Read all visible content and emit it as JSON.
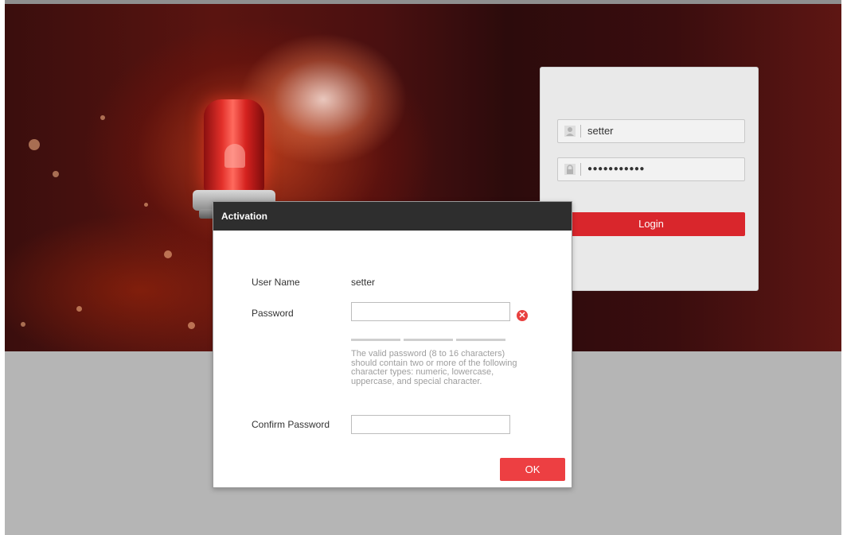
{
  "login": {
    "username_value": "setter",
    "password_value": "●●●●●●●●●●●",
    "login_label": "Login"
  },
  "dialog": {
    "title": "Activation",
    "username_label": "User Name",
    "username_value": "setter",
    "password_label": "Password",
    "password_value": "",
    "password_hint": "The valid password (8 to 16 characters) should contain two or more of the following character types: numeric, lowercase, uppercase, and special character.",
    "confirm_label": "Confirm Password",
    "confirm_value": "",
    "ok_label": "OK"
  },
  "icons": {
    "user": "user-icon",
    "lock": "lock-icon",
    "error": "error-icon"
  },
  "colors": {
    "accent_red": "#d9262c",
    "ok_red": "#ed3f42",
    "dialog_header": "#2e2e2e",
    "error_icon": "#e8403f"
  }
}
